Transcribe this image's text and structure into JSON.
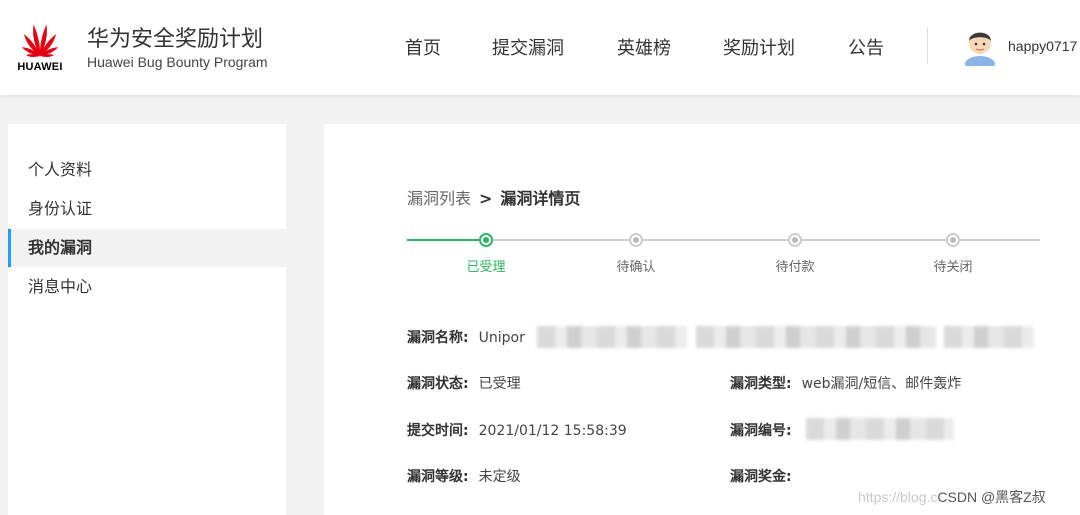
{
  "header": {
    "logo_text": "HUAWEI",
    "brand_cn": "华为安全奖励计划",
    "brand_en": "Huawei Bug Bounty Program",
    "nav": [
      "首页",
      "提交漏洞",
      "英雄榜",
      "奖励计划",
      "公告"
    ],
    "username": "happy0717"
  },
  "sidebar": {
    "items": [
      {
        "label": "个人资料",
        "active": false
      },
      {
        "label": "身份认证",
        "active": false
      },
      {
        "label": "我的漏洞",
        "active": true
      },
      {
        "label": "消息中心",
        "active": false
      }
    ]
  },
  "breadcrumb": {
    "list": "漏洞列表",
    "separator": ">",
    "current": "漏洞详情页"
  },
  "steps": [
    {
      "label": "已受理",
      "done": true
    },
    {
      "label": "待确认",
      "done": false
    },
    {
      "label": "待付款",
      "done": false
    },
    {
      "label": "待关闭",
      "done": false
    }
  ],
  "details": {
    "name_key": "漏洞名称:",
    "name_value": "Unipor",
    "status_key": "漏洞状态:",
    "status_value": "已受理",
    "type_key": "漏洞类型:",
    "type_value": "web漏洞/短信、邮件轰炸",
    "time_key": "提交时间:",
    "time_value": "2021/01/12 15:58:39",
    "id_key": "漏洞编号:",
    "level_key": "漏洞等级:",
    "level_value": "未定级",
    "bonus_key": "漏洞奖金:"
  },
  "watermark": {
    "faint": "https://blog.c",
    "text": "CSDN @黑客Z叔"
  },
  "colors": {
    "accent_green": "#2db563",
    "active_bar": "#1e9fff",
    "logo_red": "#e60012"
  }
}
